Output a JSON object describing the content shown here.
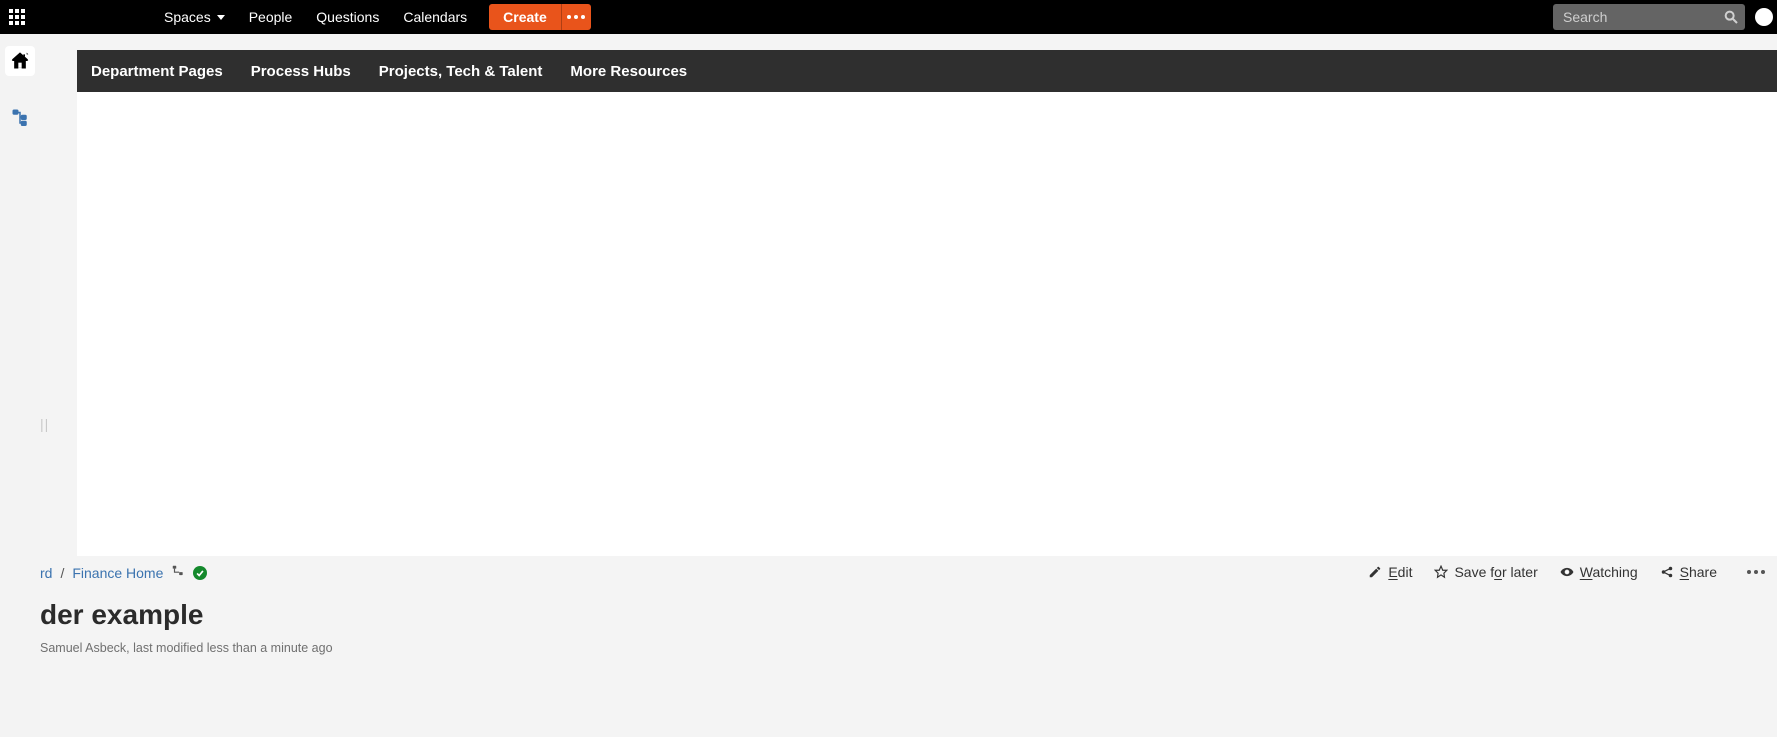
{
  "topbar": {
    "nav": [
      {
        "label": "Spaces",
        "has_dropdown": true
      },
      {
        "label": "People",
        "has_dropdown": false
      },
      {
        "label": "Questions",
        "has_dropdown": false
      },
      {
        "label": "Calendars",
        "has_dropdown": false
      }
    ],
    "create_label": "Create",
    "search_placeholder": "Search"
  },
  "subnav": {
    "items": [
      "Department Pages",
      "Process Hubs",
      "Projects, Tech & Talent",
      "More Resources"
    ]
  },
  "breadcrumb": {
    "leading_fragment": "rd",
    "separator": "/",
    "link_label": "Finance Home"
  },
  "page": {
    "title_fragment": "der example",
    "byline": "Samuel Asbeck, last modified less than a minute ago"
  },
  "actions": {
    "edit": "Edit",
    "save": "Save for later",
    "watching": "Watching",
    "share": "Share"
  }
}
